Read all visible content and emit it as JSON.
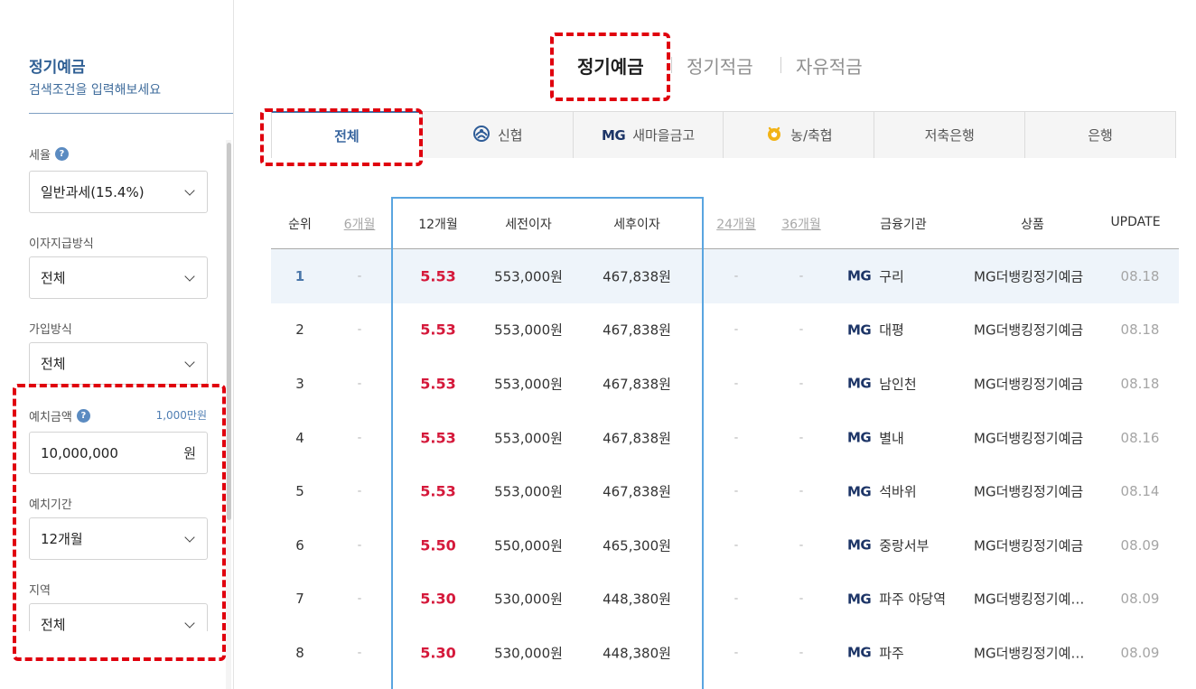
{
  "sidebar": {
    "title": "정기예금",
    "subtitle": "검색조건을 입력해보세요",
    "tax": {
      "label": "세율",
      "help": "?",
      "value": "일반과세(15.4%)"
    },
    "payment": {
      "label": "이자지급방식",
      "value": "전체"
    },
    "join": {
      "label": "가입방식",
      "value": "전체"
    },
    "amount": {
      "label": "예치금액",
      "help": "?",
      "aside": "1,000만원",
      "value": "10,000,000",
      "unit": "원"
    },
    "period": {
      "label": "예치기간",
      "value": "12개월"
    },
    "region": {
      "label": "지역",
      "value": "전체"
    }
  },
  "top_tabs": [
    {
      "label": "정기예금",
      "active": true
    },
    {
      "label": "정기적금",
      "active": false
    },
    {
      "label": "자유적금",
      "active": false
    }
  ],
  "inst_tabs": [
    {
      "label": "전체",
      "icon": "",
      "active": true
    },
    {
      "label": "신협",
      "icon": "shinhyup-logo-icon",
      "active": false
    },
    {
      "label": "새마을금고",
      "icon": "mg-logo-icon",
      "logo_text": "MG",
      "active": false
    },
    {
      "label": "농/축협",
      "icon": "nonghyup-logo-icon",
      "active": false
    },
    {
      "label": "저축은행",
      "icon": "",
      "active": false
    },
    {
      "label": "은행",
      "icon": "",
      "active": false
    }
  ],
  "table": {
    "headers": {
      "rank": "순위",
      "m6": "6개월",
      "m12": "12개월",
      "pretax": "세전이자",
      "posttax": "세후이자",
      "m24": "24개월",
      "m36": "36개월",
      "inst": "금융기관",
      "product": "상품",
      "update": "UPDATE"
    },
    "rows": [
      {
        "rank": "1",
        "m6": "-",
        "m12": "5.53",
        "pretax": "553,000원",
        "posttax": "467,838원",
        "m24": "-",
        "m36": "-",
        "logo": "MG",
        "inst": "구리",
        "product": "MG더뱅킹정기예금",
        "update": "08.18"
      },
      {
        "rank": "2",
        "m6": "-",
        "m12": "5.53",
        "pretax": "553,000원",
        "posttax": "467,838원",
        "m24": "-",
        "m36": "-",
        "logo": "MG",
        "inst": "대평",
        "product": "MG더뱅킹정기예금",
        "update": "08.18"
      },
      {
        "rank": "3",
        "m6": "-",
        "m12": "5.53",
        "pretax": "553,000원",
        "posttax": "467,838원",
        "m24": "-",
        "m36": "-",
        "logo": "MG",
        "inst": "남인천",
        "product": "MG더뱅킹정기예금",
        "update": "08.18"
      },
      {
        "rank": "4",
        "m6": "-",
        "m12": "5.53",
        "pretax": "553,000원",
        "posttax": "467,838원",
        "m24": "-",
        "m36": "-",
        "logo": "MG",
        "inst": "별내",
        "product": "MG더뱅킹정기예금",
        "update": "08.16"
      },
      {
        "rank": "5",
        "m6": "-",
        "m12": "5.53",
        "pretax": "553,000원",
        "posttax": "467,838원",
        "m24": "-",
        "m36": "-",
        "logo": "MG",
        "inst": "석바위",
        "product": "MG더뱅킹정기예금",
        "update": "08.14"
      },
      {
        "rank": "6",
        "m6": "-",
        "m12": "5.50",
        "pretax": "550,000원",
        "posttax": "465,300원",
        "m24": "-",
        "m36": "-",
        "logo": "MG",
        "inst": "중랑서부",
        "product": "MG더뱅킹정기예금",
        "update": "08.09"
      },
      {
        "rank": "7",
        "m6": "-",
        "m12": "5.30",
        "pretax": "530,000원",
        "posttax": "448,380원",
        "m24": "-",
        "m36": "-",
        "logo": "MG",
        "inst": "파주 야당역",
        "product": "MG더뱅킹정기예…",
        "update": "08.09"
      },
      {
        "rank": "8",
        "m6": "-",
        "m12": "5.30",
        "pretax": "530,000원",
        "posttax": "448,380원",
        "m24": "-",
        "m36": "-",
        "logo": "MG",
        "inst": "파주",
        "product": "MG더뱅킹정기예…",
        "update": "08.09"
      }
    ]
  },
  "colors": {
    "accent_blue": "#3a67a0",
    "rate_red": "#d5193b",
    "highlight_row": "#eef4fa",
    "annotation_red": "#e0000e",
    "column_box_blue": "#5aa5e0"
  }
}
